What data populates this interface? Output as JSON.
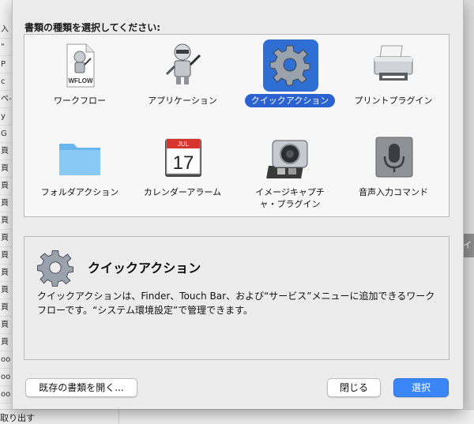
{
  "background": {
    "left_rows": [
      "入",
      "\"",
      "P",
      "c",
      "ペ-",
      "y",
      "G",
      "頁",
      "頁",
      "頁",
      "頁",
      "頁",
      "頁",
      "頁",
      "頁",
      "頁",
      "頁",
      "頁",
      "頁",
      "oo",
      "oo",
      "oo"
    ],
    "bottom_text": "取り出す",
    "right_tab_text": "イ"
  },
  "dialog": {
    "title": "書類の種類を選択してください:",
    "types": [
      {
        "label": "ワークフロー",
        "icon": "workflow-document-icon",
        "selected": false
      },
      {
        "label": "アプリケーション",
        "icon": "automator-robot-icon",
        "selected": false
      },
      {
        "label": "クイックアクション",
        "icon": "gear-icon",
        "selected": true
      },
      {
        "label": "プリントプラグイン",
        "icon": "printer-icon",
        "selected": false
      },
      {
        "label": "フォルダアクション",
        "icon": "folder-icon",
        "selected": false
      },
      {
        "label": "カレンダーアラーム",
        "icon": "calendar-icon",
        "selected": false
      },
      {
        "label": "イメージキャプチャ・プラグイン",
        "label_lines": [
          "イメージキャプチ",
          "ャ・プラグイン"
        ],
        "icon": "image-capture-icon",
        "selected": false
      },
      {
        "label": "音声入力コマンド",
        "icon": "microphone-icon",
        "selected": false
      }
    ],
    "icon_texts": {
      "wflow": "WFLOW",
      "cal_month": "JUL",
      "cal_day": "17"
    },
    "description": {
      "title": "クイックアクション",
      "text": "クイックアクションは、Finder、Touch Bar、および“サービス”メニューに追加できるワークフローです。“システム環境設定”で管理できます。"
    },
    "buttons": {
      "open_existing": "既存の書類を開く...",
      "close": "閉じる",
      "choose": "選択"
    }
  },
  "colors": {
    "accent": "#3b86f7",
    "selection": "#2a62d0"
  }
}
